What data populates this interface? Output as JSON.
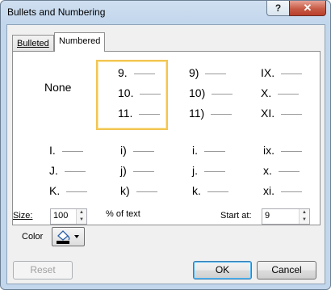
{
  "dialog": {
    "title": "Bullets and Numbering",
    "help_label": "?",
    "close_label": "✕"
  },
  "tabs": [
    {
      "label": "Bulleted"
    },
    {
      "label": "Numbered"
    }
  ],
  "styles": {
    "none_label": "None",
    "cells": [
      [
        "9.",
        "10.",
        "11."
      ],
      [
        "9)",
        "10)",
        "11)"
      ],
      [
        "IX.",
        "X.",
        "XI."
      ],
      [
        "I.",
        "J.",
        "K."
      ],
      [
        "i)",
        "j)",
        "k)"
      ],
      [
        "i.",
        "j.",
        "k."
      ],
      [
        "ix.",
        "x.",
        "xi."
      ]
    ]
  },
  "size": {
    "label": "Size:",
    "value": "100",
    "suffix": "% of text"
  },
  "start_at": {
    "label": "Start at:",
    "value": "9"
  },
  "color": {
    "label": "Color",
    "icon": "paint-bucket-icon",
    "swatch": "#000000"
  },
  "buttons": {
    "reset": "Reset",
    "ok": "OK",
    "cancel": "Cancel"
  },
  "colors": {
    "selection": "#f2c552",
    "accent": "#3c7fb1"
  }
}
